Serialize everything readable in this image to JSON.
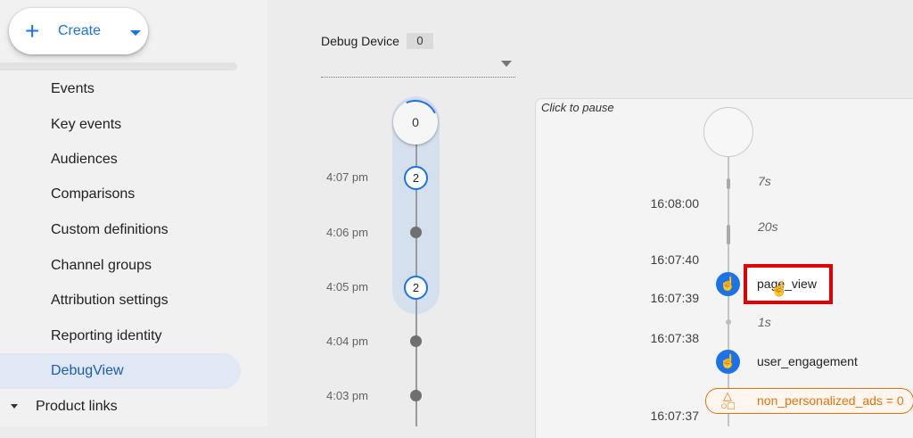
{
  "sidebar": {
    "create_label": "Create",
    "items": [
      {
        "label": "Events"
      },
      {
        "label": "Key events"
      },
      {
        "label": "Audiences"
      },
      {
        "label": "Comparisons"
      },
      {
        "label": "Custom definitions"
      },
      {
        "label": "Channel groups"
      },
      {
        "label": "Attribution settings"
      },
      {
        "label": "Reporting identity"
      },
      {
        "label": "DebugView",
        "active": true
      }
    ],
    "product_links_label": "Product links"
  },
  "debug_device": {
    "label": "Debug Device",
    "count": "0"
  },
  "minutes_stream": {
    "top_count": "0",
    "entries": [
      {
        "time": "4:07 pm",
        "count": "2"
      },
      {
        "time": "4:06 pm",
        "count": null
      },
      {
        "time": "4:05 pm",
        "count": "2"
      },
      {
        "time": "4:04 pm",
        "count": null
      },
      {
        "time": "4:03 pm",
        "count": null
      }
    ]
  },
  "seconds_stream": {
    "pause_hint": "Click to pause",
    "durations": [
      "7s",
      "20s",
      "1s"
    ],
    "timestamps": [
      "16:08:00",
      "16:07:40",
      "16:07:39",
      "16:07:38",
      "16:07:37"
    ],
    "events": [
      {
        "name": "page_view",
        "icon": "touch-icon",
        "highlighted": true
      },
      {
        "name": "user_engagement",
        "icon": "touch-icon",
        "highlighted": false
      }
    ],
    "parameter_chip": {
      "label": "non_personalized_ads = 0",
      "icon": "shapes-icon"
    }
  },
  "colors": {
    "accent": "#1a73e8",
    "highlight_box": "#e00000",
    "chip_orange": "#e8710a"
  }
}
